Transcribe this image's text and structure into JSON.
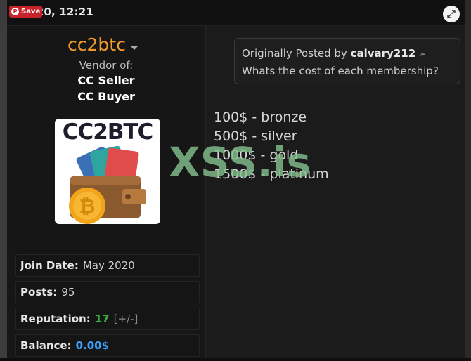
{
  "header": {
    "post_date": "-2020, 12:21",
    "save_label": "Save",
    "pin_glyph": "P",
    "expand_icon": "expand-arrows-icon"
  },
  "user": {
    "username": "cc2btc",
    "vendor_of_label": "Vendor of:",
    "badges": [
      "CC Seller",
      "CC Buyer"
    ],
    "avatar_text": "CC2BTC",
    "avatar_icon": "wallet-bitcoin-icon"
  },
  "stats": {
    "join_label": "Join Date:",
    "join_value": "May 2020",
    "posts_label": "Posts:",
    "posts_value": "95",
    "rep_label": "Reputation:",
    "rep_value": "17",
    "rep_link": "[+/-]",
    "balance_label": "Balance:",
    "balance_value": "0.00$"
  },
  "quote": {
    "prefix": "Originally Posted by",
    "author": "calvary212",
    "text": "Whats the cost of each membership?"
  },
  "post": {
    "tiers": [
      "100$ - bronze",
      "500$ - silver",
      "1000$ - gold",
      "1500$ - platinum"
    ]
  },
  "watermark": "XSS.is",
  "colors": {
    "username": "#f29a2a",
    "reputation": "#3cb23c",
    "balance": "#3aa3ff",
    "save_button": "#c8232c",
    "watermark": "#82be8c"
  }
}
